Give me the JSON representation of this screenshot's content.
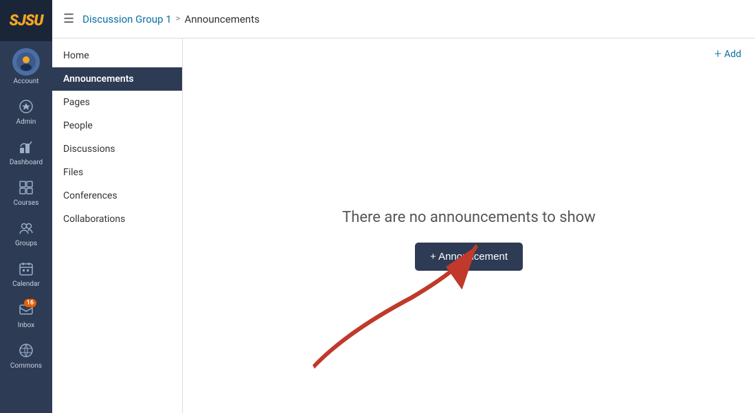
{
  "branding": {
    "logo_text": "SJSU"
  },
  "topbar": {
    "breadcrumb_link": "Discussion Group 1",
    "breadcrumb_separator": ">",
    "breadcrumb_current": "Announcements"
  },
  "nav": {
    "items": [
      {
        "id": "account",
        "label": "Account",
        "icon": "avatar"
      },
      {
        "id": "admin",
        "label": "Admin",
        "icon": "admin"
      },
      {
        "id": "dashboard",
        "label": "Dashboard",
        "icon": "dashboard"
      },
      {
        "id": "courses",
        "label": "Courses",
        "icon": "courses"
      },
      {
        "id": "groups",
        "label": "Groups",
        "icon": "groups"
      },
      {
        "id": "calendar",
        "label": "Calendar",
        "icon": "calendar"
      },
      {
        "id": "inbox",
        "label": "Inbox",
        "icon": "inbox",
        "badge": "16"
      },
      {
        "id": "commons",
        "label": "Commons",
        "icon": "commons"
      }
    ]
  },
  "sidebar": {
    "items": [
      {
        "id": "home",
        "label": "Home",
        "active": false
      },
      {
        "id": "announcements",
        "label": "Announcements",
        "active": true
      },
      {
        "id": "pages",
        "label": "Pages",
        "active": false
      },
      {
        "id": "people",
        "label": "People",
        "active": false
      },
      {
        "id": "discussions",
        "label": "Discussions",
        "active": false
      },
      {
        "id": "files",
        "label": "Files",
        "active": false
      },
      {
        "id": "conferences",
        "label": "Conferences",
        "active": false
      },
      {
        "id": "collaborations",
        "label": "Collaborations",
        "active": false
      }
    ]
  },
  "content": {
    "add_label": "Add",
    "empty_message": "There are no announcements to show",
    "add_button_label": "+ Announcement"
  }
}
